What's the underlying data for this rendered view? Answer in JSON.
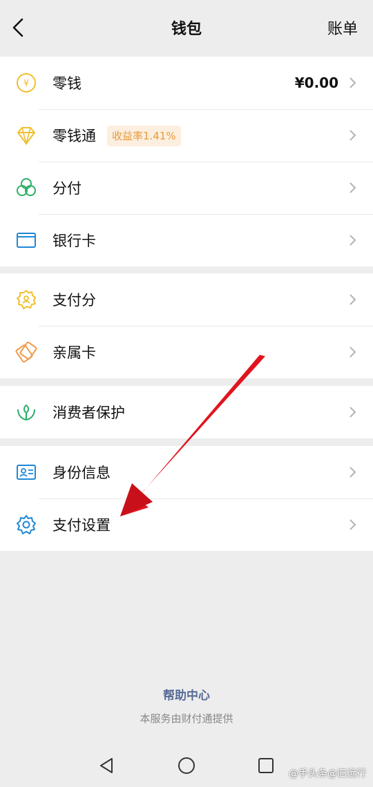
{
  "header": {
    "title": "钱包",
    "bill_label": "账单"
  },
  "group1": {
    "items": [
      {
        "label": "零钱",
        "value": "¥0.00",
        "icon": "yuan-coin-icon"
      },
      {
        "label": "零钱通",
        "badge": "收益率1.41%",
        "icon": "diamond-icon"
      },
      {
        "label": "分付",
        "icon": "fenfu-icon"
      },
      {
        "label": "银行卡",
        "icon": "bank-card-icon"
      }
    ]
  },
  "group2": {
    "items": [
      {
        "label": "支付分",
        "icon": "credit-score-icon"
      },
      {
        "label": "亲属卡",
        "icon": "family-card-icon"
      }
    ]
  },
  "group3": {
    "items": [
      {
        "label": "消费者保护",
        "icon": "protection-hands-icon"
      }
    ]
  },
  "group4": {
    "items": [
      {
        "label": "身份信息",
        "icon": "id-card-icon"
      },
      {
        "label": "支付设置",
        "icon": "gear-icon"
      }
    ]
  },
  "footer": {
    "help_center": "帮助中心",
    "provider": "本服务由财付通提供"
  },
  "watermark": "@手头条@旧远行",
  "colors": {
    "background": "#ededed",
    "link_blue": "#576b95",
    "badge_text": "#e99a3b",
    "badge_bg": "#fcefdf",
    "arrow_red": "#e0141e"
  }
}
